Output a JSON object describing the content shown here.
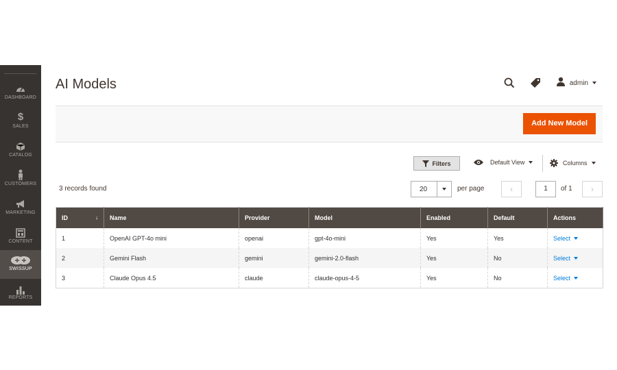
{
  "sidebar": {
    "items": [
      {
        "label": "DASHBOARD",
        "icon": "dashboard-icon"
      },
      {
        "label": "SALES",
        "icon": "dollar-icon"
      },
      {
        "label": "CATALOG",
        "icon": "cube-icon"
      },
      {
        "label": "CUSTOMERS",
        "icon": "person-icon"
      },
      {
        "label": "MARKETING",
        "icon": "megaphone-icon"
      },
      {
        "label": "CONTENT",
        "icon": "layout-icon"
      },
      {
        "label": "SWISSUP",
        "icon": "swissup-icon"
      },
      {
        "label": "REPORTS",
        "icon": "bar-chart-icon"
      }
    ],
    "active": "SWISSUP"
  },
  "header": {
    "title": "AI Models",
    "user": "admin"
  },
  "action_bar": {
    "add_label": "Add New Model",
    "accent": "#eb5202"
  },
  "toolbar": {
    "filters_label": "Filters",
    "view_label": "Default View",
    "columns_label": "Columns",
    "records_found": "3 records found",
    "per_page_value": "20",
    "per_page_label": "per page",
    "page_value": "1",
    "page_of": "of 1"
  },
  "grid": {
    "header_color": "#514943",
    "columns": [
      "ID",
      "Name",
      "Provider",
      "Model",
      "Enabled",
      "Default",
      "Actions"
    ],
    "rows": [
      {
        "id": "1",
        "name": "OpenAI GPT-4o mini",
        "provider": "openai",
        "model": "gpt-4o-mini",
        "enabled": "Yes",
        "default": "Yes",
        "action": "Select"
      },
      {
        "id": "2",
        "name": "Gemini Flash",
        "provider": "gemini",
        "model": "gemini-2.0-flash",
        "enabled": "Yes",
        "default": "No",
        "action": "Select"
      },
      {
        "id": "3",
        "name": "Claude Opus 4.5",
        "provider": "claude",
        "model": "claude-opus-4-5",
        "enabled": "Yes",
        "default": "No",
        "action": "Select"
      }
    ]
  }
}
